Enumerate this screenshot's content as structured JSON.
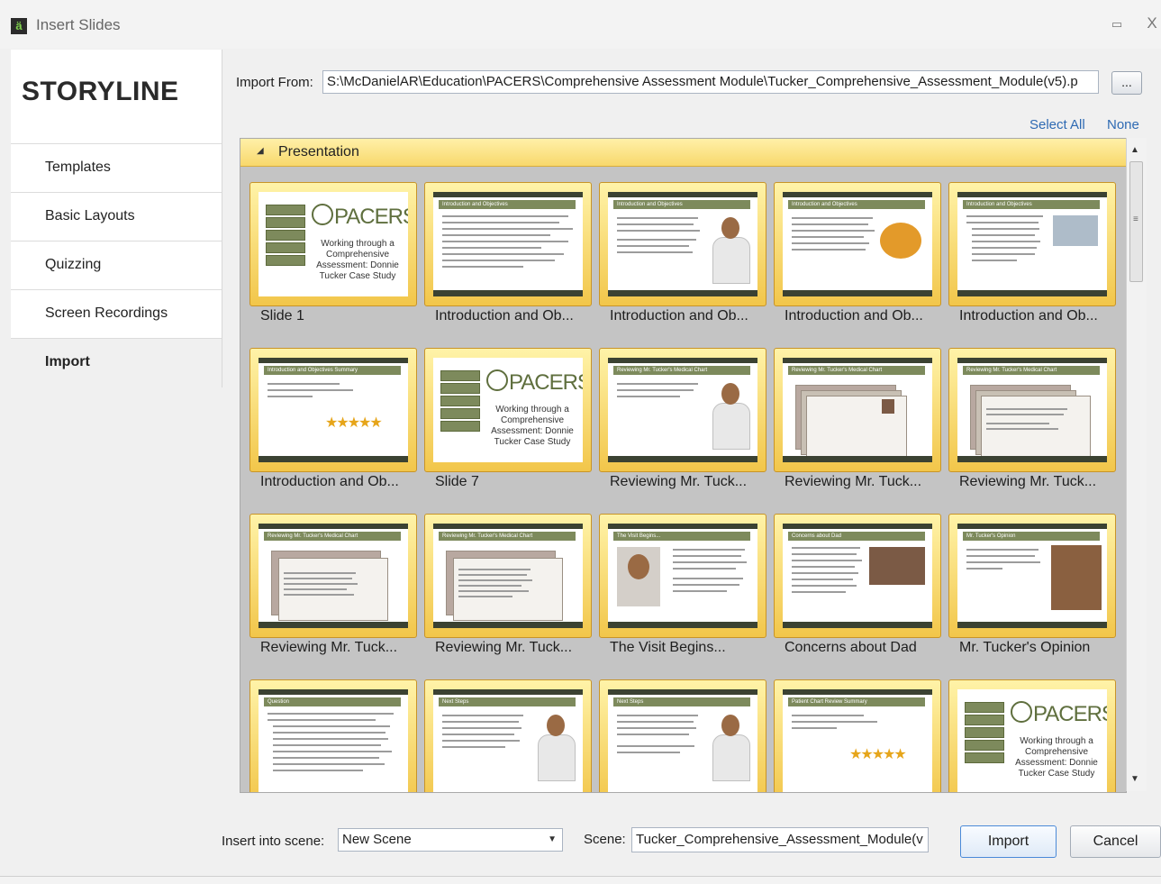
{
  "window": {
    "title": "Insert Slides",
    "app_icon": "storyline-app-icon",
    "minimize_glyph": "▭",
    "close_glyph": "X",
    "app_icon_glyph": "ä"
  },
  "sidebar": {
    "brand": "STORYLINE",
    "items": [
      {
        "label": "Templates",
        "active": false
      },
      {
        "label": "Basic Layouts",
        "active": false
      },
      {
        "label": "Quizzing",
        "active": false
      },
      {
        "label": "Screen Recordings",
        "active": false
      },
      {
        "label": "Import",
        "active": true
      }
    ]
  },
  "import": {
    "label": "Import From:",
    "path": "S:\\McDanielAR\\Education\\PACERS\\Comprehensive Assessment Module\\Tucker_Comprehensive_Assessment_Module(v5).p",
    "browse_label": "...",
    "select_all_label": "Select All",
    "none_label": "None"
  },
  "gallery": {
    "section_label": "Presentation",
    "section_glyph": "◢",
    "slides": [
      {
        "caption": "Slide 1"
      },
      {
        "caption": "Introduction and Ob..."
      },
      {
        "caption": "Introduction and Ob..."
      },
      {
        "caption": "Introduction and Ob..."
      },
      {
        "caption": "Introduction and Ob..."
      },
      {
        "caption": "Introduction and Ob..."
      },
      {
        "caption": "Slide 7"
      },
      {
        "caption": "Reviewing Mr. Tuck..."
      },
      {
        "caption": "Reviewing Mr. Tuck..."
      },
      {
        "caption": "Reviewing Mr. Tuck..."
      },
      {
        "caption": "Reviewing Mr. Tuck..."
      },
      {
        "caption": "Reviewing Mr. Tuck..."
      },
      {
        "caption": "The Visit Begins..."
      },
      {
        "caption": "Concerns about Dad"
      },
      {
        "caption": "Mr. Tucker's Opinion"
      },
      {
        "caption": ""
      },
      {
        "caption": ""
      },
      {
        "caption": ""
      },
      {
        "caption": ""
      },
      {
        "caption": ""
      }
    ],
    "thumb_text": {
      "pacers": "PACERS",
      "pacers_sub": "Working through a Comprehensive Assessment: Donnie Tucker Case Study",
      "intro": "Introduction and Objectives",
      "intro_summary": "Introduction and Objectives Summary",
      "review": "Reviewing Mr. Tucker's Medical Chart",
      "visit": "The Visit Begins...",
      "concerns": "Concerns about Dad",
      "opinion": "Mr. Tucker's Opinion",
      "question": "Question",
      "next": "Next Steps",
      "summary": "Patient Chart Review Summary"
    }
  },
  "footer": {
    "insert_label": "Insert into scene:",
    "insert_value": "New Scene",
    "scene_label": "Scene:",
    "scene_value": "Tucker_Comprehensive_Assessment_Module(v",
    "import_button": "Import",
    "cancel_button": "Cancel"
  },
  "colors": {
    "accent": "#2e6ab3",
    "selection_gold": "#f2c64a",
    "slide_olive": "#7d8a5c",
    "panel_gray": "#c4c4c4"
  }
}
